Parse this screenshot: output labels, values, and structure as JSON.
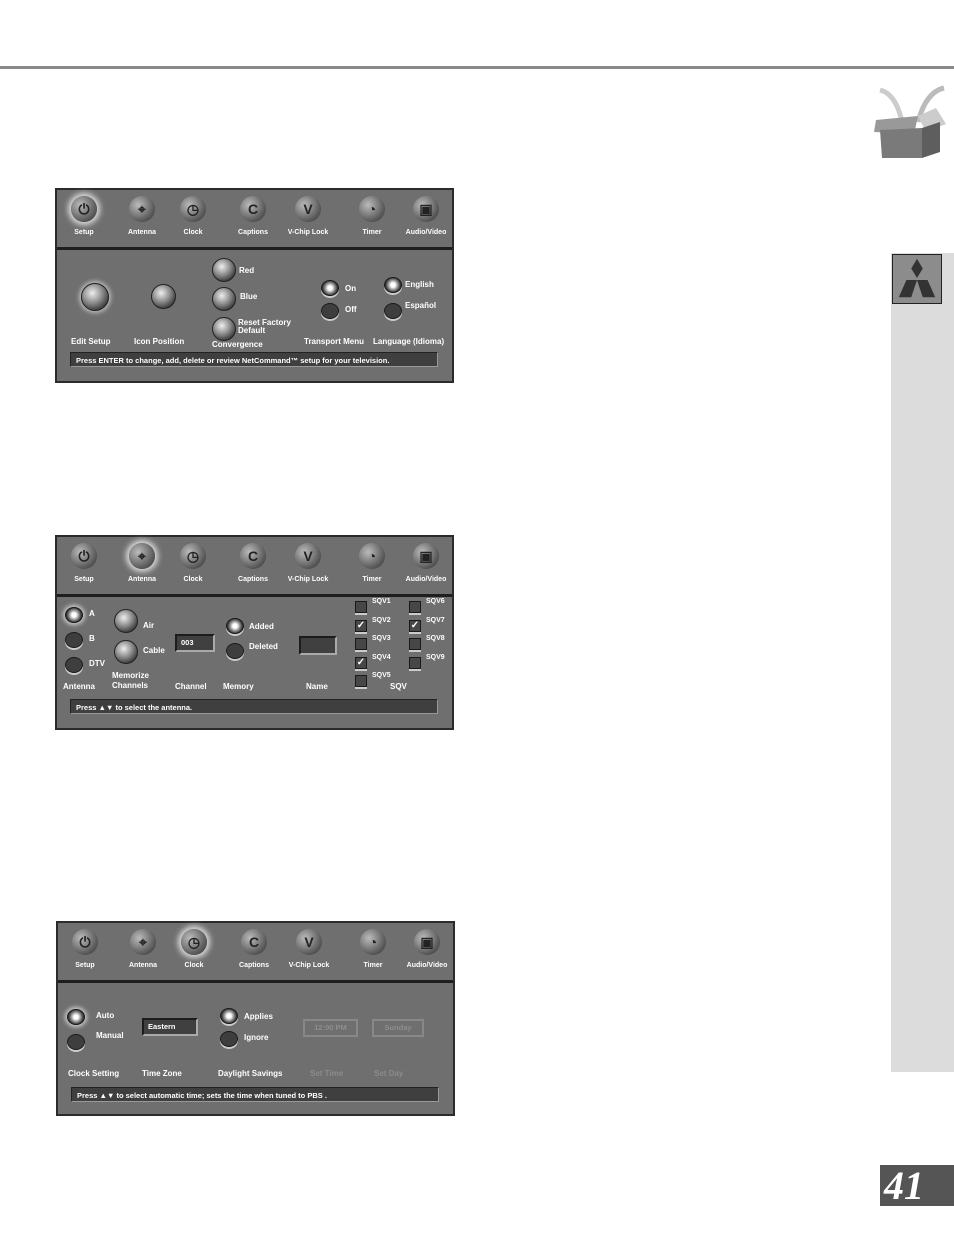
{
  "page_number": "41",
  "tabs": [
    "Setup",
    "Antenna",
    "Clock",
    "Captions",
    "V-Chip Lock",
    "Timer",
    "Audio/Video"
  ],
  "tab_icons": [
    "plug-icon",
    "antenna-icon",
    "clock-icon",
    "captions-icon",
    "lock-icon",
    "timer-icon",
    "audio-video-icon"
  ],
  "panel1": {
    "selected_tab": 0,
    "edit_setup": "Edit Setup",
    "icon_position": "Icon Position",
    "convergence": {
      "label": "Convergence",
      "red": "Red",
      "blue": "Blue",
      "reset": "Reset Factory Default"
    },
    "transport": {
      "label": "Transport Menu",
      "on": "On",
      "off": "Off",
      "selected": "On"
    },
    "language": {
      "label": "Language (Idioma)",
      "english": "English",
      "espanol": "Español",
      "selected": "English"
    },
    "status": "Press ENTER to change, add, delete or review NetCommand™ setup for your television."
  },
  "panel2": {
    "selected_tab": 1,
    "antenna": {
      "label": "Antenna",
      "a": "A",
      "b": "B",
      "dtv": "DTV",
      "selected": "A"
    },
    "memorize": {
      "label": "Memorize Channels",
      "air": "Air",
      "cable": "Cable"
    },
    "channel": {
      "label": "Channel",
      "value": "003"
    },
    "memory": {
      "label": "Memory",
      "added": "Added",
      "deleted": "Deleted",
      "selected": "Added"
    },
    "name": {
      "label": "Name",
      "value": ""
    },
    "sqv": {
      "label": "SQV",
      "items": [
        {
          "label": "SQV1",
          "checked": false
        },
        {
          "label": "SQV2",
          "checked": true
        },
        {
          "label": "SQV3",
          "checked": false
        },
        {
          "label": "SQV4",
          "checked": true
        },
        {
          "label": "SQV5",
          "checked": false
        },
        {
          "label": "SQV6",
          "checked": false
        },
        {
          "label": "SQV7",
          "checked": true
        },
        {
          "label": "SQV8",
          "checked": false
        },
        {
          "label": "SQV9",
          "checked": false
        }
      ]
    },
    "status": "Press ▲▼ to select the antenna."
  },
  "panel3": {
    "selected_tab": 2,
    "clock_setting": {
      "label": "Clock Setting",
      "auto": "Auto",
      "manual": "Manual",
      "selected": "Auto"
    },
    "time_zone": {
      "label": "Time Zone",
      "value": "Eastern"
    },
    "daylight": {
      "label": "Daylight Savings",
      "applies": "Applies",
      "ignore": "Ignore",
      "selected": "Applies"
    },
    "set_time": {
      "label": "Set Time",
      "value": "12:00 PM"
    },
    "set_day": {
      "label": "Set Day",
      "value": "Sunday"
    },
    "status": "Press ▲▼ to select automatic time; sets the time when tuned to PBS ."
  }
}
